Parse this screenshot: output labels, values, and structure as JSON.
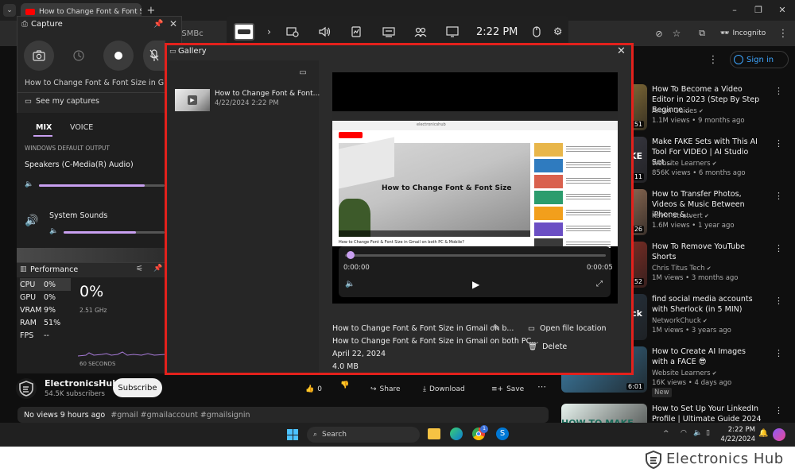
{
  "browser": {
    "tab_title": "How to Change Font & Font Size",
    "address_fragment": "3SMBc",
    "incognito_label": "Incognito"
  },
  "youtube": {
    "sign_in": "Sign in",
    "channel_name": "ElectronicsHub",
    "subscribers": "54.5K subscribers",
    "subscribe": "Subscribe",
    "likes": "0",
    "share": "Share",
    "download": "Download",
    "save": "Save",
    "description_stats": "No views  9 hours ago",
    "description_tags": "#gmail #gmailaccount #gmailsignin"
  },
  "recommended": [
    {
      "title": "How To Become a Video Editor in 2023 (Step By Step Beginne...",
      "channel": "Aman Guides",
      "meta": "1.1M views • 9 months ago",
      "duration": ":51",
      "thumb_color": "#c8a24a"
    },
    {
      "title": "Make FAKE Sets with This AI Tool For VIDEO | AI Studio Set...",
      "channel": "Website Learners",
      "meta": "856K views • 6 months ago",
      "duration": ":11",
      "thumb_color": "#4a4a5a",
      "thumb_text": "AKE"
    },
    {
      "title": "How to Transfer Photos, Videos & Music Between iPhone &...",
      "channel": "Kevin Stratvert",
      "meta": "1.6M views • 1 year ago",
      "duration": ":26",
      "thumb_color": "#d9a07a"
    },
    {
      "title": "How To Remove YouTube Shorts",
      "channel": "Chris Titus Tech",
      "meta": "1M views • 3 months ago",
      "duration": ":52",
      "thumb_color": "#c0392b"
    },
    {
      "title": "find social media accounts with Sherlock (in 5 MIN)",
      "channel": "NetworkChuck",
      "meta": "1M views • 3 years ago",
      "duration": "",
      "thumb_color": "#2c3e50",
      "thumb_text": "ck"
    },
    {
      "title": "How to Create AI Images with a FACE 😎",
      "channel": "Website Learners",
      "meta": "16K views • 4 days ago",
      "badge": "New",
      "duration": "6:01",
      "thumb_color": "#3d7ea6"
    },
    {
      "title": "How to Set Up Your LinkedIn Profile | Ultimate Guide 2024",
      "channel": "",
      "meta": "",
      "duration": "",
      "thumb_color": "#e7f3ee",
      "thumb_text": "HOW TO MAKE A"
    }
  ],
  "gamebar": {
    "time": "2:22 PM"
  },
  "capture": {
    "title": "Capture",
    "video_title": "How to Change Font & Font Size in Gmail on",
    "see_captures": "See my captures",
    "tab_mix": "MIX",
    "tab_voice": "VOICE",
    "section_label": "WINDOWS DEFAULT OUTPUT",
    "device": "Speakers (C-Media(R) Audio)",
    "system_sounds": "System Sounds",
    "device_volume": 0.84,
    "system_volume": 0.72
  },
  "performance": {
    "title": "Performance",
    "metrics": [
      {
        "label": "CPU",
        "value": "0%"
      },
      {
        "label": "GPU",
        "value": "0%"
      },
      {
        "label": "VRAM",
        "value": "9%"
      },
      {
        "label": "RAM",
        "value": "51%"
      },
      {
        "label": "FPS",
        "value": "--"
      }
    ],
    "big_value": "0%",
    "clock": "2.51 GHz",
    "window": "60 SECONDS"
  },
  "gallery": {
    "title": "Gallery",
    "item_title": "How to Change Font & Font...",
    "item_date": "4/22/2024 2:22 PM",
    "preview_heading": "How to Change Font & Font Size",
    "preview_caption": "How to Change Font & Font Size in Gmail on both PC & Mobile?",
    "preview_url": "electronicshub",
    "time_start": "0:00:00",
    "time_end": "0:00:05",
    "file_name": "How to Change Font & Font Size in Gmail on b...",
    "full_title": "How to Change Font & Font Size in Gmail on both PC...",
    "date": "April 22, 2024",
    "size": "4.0 MB",
    "open_location": "Open file location",
    "delete": "Delete"
  },
  "taskbar": {
    "search": "Search",
    "time": "2:22 PM",
    "date": "4/22/2024",
    "badge": "1"
  },
  "brand": {
    "name": "Electronics Hub"
  }
}
